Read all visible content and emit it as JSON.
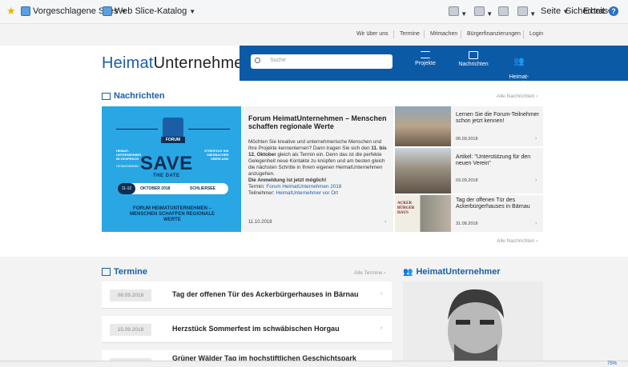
{
  "browser": {
    "favorites": [
      {
        "label": "Vorgeschlagene Sites"
      },
      {
        "label": "Web Slice-Katalog"
      }
    ],
    "commands": {
      "page": "Seite",
      "security": "Sicherheit",
      "extras": "Extras"
    },
    "zoom": "75%"
  },
  "topnav": [
    "Wir über uns",
    "Termine",
    "Mitmachen",
    "Bürgerfinanzierungen",
    "Login"
  ],
  "header": {
    "logo_a": "Heimat",
    "logo_b": "Unternehmen",
    "search_placeholder": "Suche",
    "nav": [
      {
        "label": "Projekte"
      },
      {
        "label": "Nachrichten"
      },
      {
        "label": "Heimat-\nUnternehmer"
      }
    ]
  },
  "news": {
    "heading": "Nachrichten",
    "more_top": "Alle Nachrichten",
    "more_bottom": "Alle Nachrichten",
    "feature": {
      "badge": "FORUM",
      "left_text": "HEIMAT-\nUNTERNEHMER\nIM GESPRÄCH",
      "left_sub": "HEIMATABEND",
      "right_text": "STREIFZUG INS\nWIESBACHER\nOBERLAND",
      "save": "SAVE",
      "the_date": "THE DATE",
      "pill_num": "11-12",
      "pill_month": "OKTOBER 2018",
      "pill_place": "SCHLIERSEE",
      "bottom": "FORUM HEIMATUNTERNEHMEN –\nMENSCHEN SCHAFFEN REGIONALE\nWERTE"
    },
    "main": {
      "title": "Forum HeimatUnternehmen – Menschen schaffen regionale Werte",
      "body_1": "Möchten Sie kreative und unternehmerische Menschen und Ihre Projekte kennenlernen? Dann tragen Sie sich den ",
      "body_bold": "11. bis 12. Oktober",
      "body_2": " gleich als Termin ein. Denn das ist die perfekte Gelegenheit neue Kontakte zu knüpfen und am besten gleich die nächsten Schritte in Ihrem eigenen HeimatUnternehmen anzugehen.",
      "body_bold_2": "Die Anmeldung ist jetzt möglich!",
      "termin_label": "Termin: ",
      "termin_link": "Forum HeimatUnternehmen 2018",
      "teil_label": "Teilnehmer: ",
      "teil_link": "HeimatUnternehmer vor Ort",
      "date": "11.10.2018"
    },
    "side": [
      {
        "title": "Lernen Sie die Forum-Teilnehmer schon jetzt kennen!",
        "date": "06.09.2018"
      },
      {
        "title": "Artikel: \"Unterstützung für den neuen Verein\"",
        "date": "03.09.2018"
      },
      {
        "title": "Tag der offenen Tür des Ackerbürgerhauses in Bärnau",
        "date": "31.08.2018"
      }
    ]
  },
  "termine": {
    "heading": "Termine",
    "more": "Alle Termine",
    "items": [
      {
        "date": "08.09.2018",
        "title": "Tag der offenen Tür des Ackerbürgerhauses in Bärnau"
      },
      {
        "date": "15.09.2018",
        "title": "Herzstück Sommerfest im schwäbischen Horgau"
      },
      {
        "date": "",
        "title": "Grüner Wälder Tag im hochstiftlichen Geschichtspark"
      }
    ]
  },
  "unternehmer": {
    "heading": "HeimatUnternehmer"
  }
}
